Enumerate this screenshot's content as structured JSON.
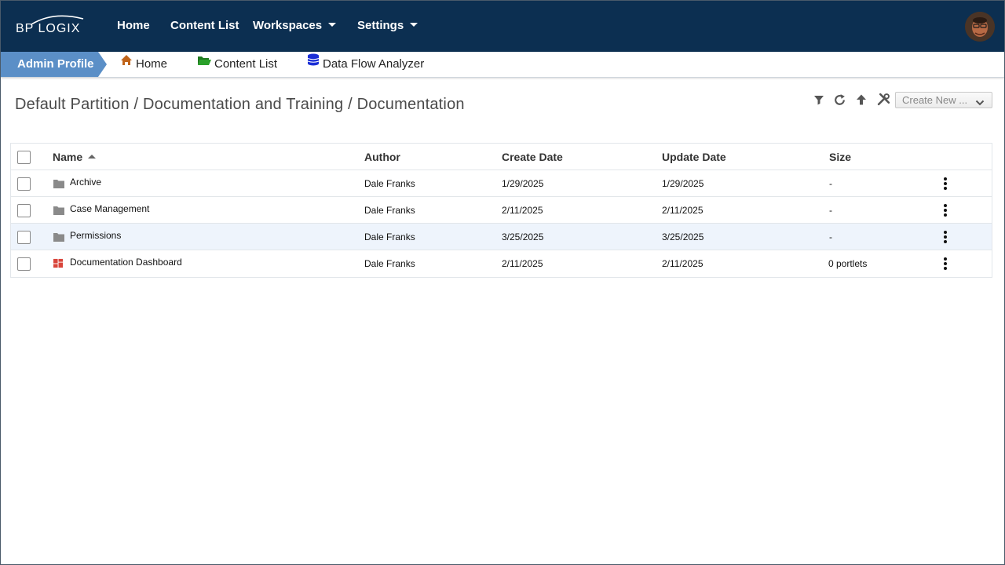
{
  "app": {
    "logo_text": "BP LOGIX",
    "nav": [
      {
        "label": "Home",
        "has_caret": false
      },
      {
        "label": "Content List",
        "has_caret": false
      },
      {
        "label": "Workspaces",
        "has_caret": true
      },
      {
        "label": "Settings",
        "has_caret": true
      }
    ],
    "avatar_icon": "user-avatar"
  },
  "tabbar": {
    "profile_label": "Admin Profile",
    "links": [
      {
        "label": "Home",
        "icon": "home-icon",
        "color": "#c0641a"
      },
      {
        "label": "Content List",
        "icon": "folder-open-icon",
        "color": "#1f8a1f"
      },
      {
        "label": "Data Flow Analyzer",
        "icon": "database-icon",
        "color": "#1a2ed6"
      }
    ]
  },
  "page": {
    "breadcrumb": "Default Partition / Documentation and Training / Documentation",
    "tools": [
      "filter-icon",
      "refresh-icon",
      "arrow-up-icon",
      "tools-icon"
    ],
    "create_new_label": "Create New ..."
  },
  "table": {
    "columns": [
      "Name",
      "Author",
      "Create Date",
      "Update Date",
      "Size"
    ],
    "sort": {
      "column": "Name",
      "direction": "asc"
    },
    "rows": [
      {
        "name": "Archive",
        "type": "folder",
        "author": "Dale Franks",
        "create": "1/29/2025",
        "update": "1/29/2025",
        "size": "-",
        "highlight": false
      },
      {
        "name": "Case Management",
        "type": "folder",
        "author": "Dale Franks",
        "create": "2/11/2025",
        "update": "2/11/2025",
        "size": "-",
        "highlight": false
      },
      {
        "name": "Permissions",
        "type": "folder",
        "author": "Dale Franks",
        "create": "3/25/2025",
        "update": "3/25/2025",
        "size": "-",
        "highlight": true
      },
      {
        "name": "Documentation Dashboard",
        "type": "dashboard",
        "author": "Dale Franks",
        "create": "2/11/2025",
        "update": "2/11/2025",
        "size": "0 portlets",
        "highlight": false
      }
    ]
  },
  "colors": {
    "navbar": "#0c2f51",
    "profile_tab": "#5b8fc7",
    "row_highlight": "#eef4fc",
    "dashboard_icon": "#d9453b",
    "folder_icon": "#8a8a8a"
  }
}
